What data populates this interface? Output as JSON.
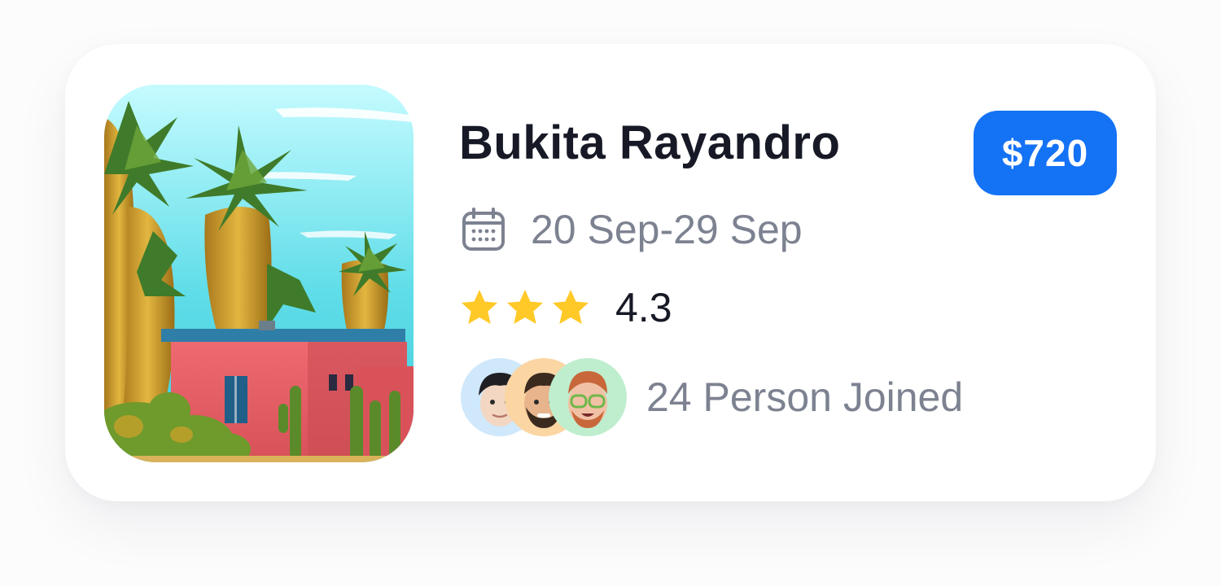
{
  "card": {
    "title": "Bukita Rayandro",
    "price": "$720",
    "dates": "20 Sep-29 Sep",
    "rating": {
      "value": "4.3",
      "stars_shown": 3
    },
    "participants": {
      "label": "24 Person Joined",
      "avatars": [
        "avatar-1",
        "avatar-2",
        "avatar-3"
      ]
    },
    "icons": {
      "calendar": "calendar-icon",
      "star": "star-icon"
    },
    "colors": {
      "accent": "#1472f5",
      "title": "#171a26",
      "muted": "#7d8291",
      "star": "#ffc928"
    }
  }
}
